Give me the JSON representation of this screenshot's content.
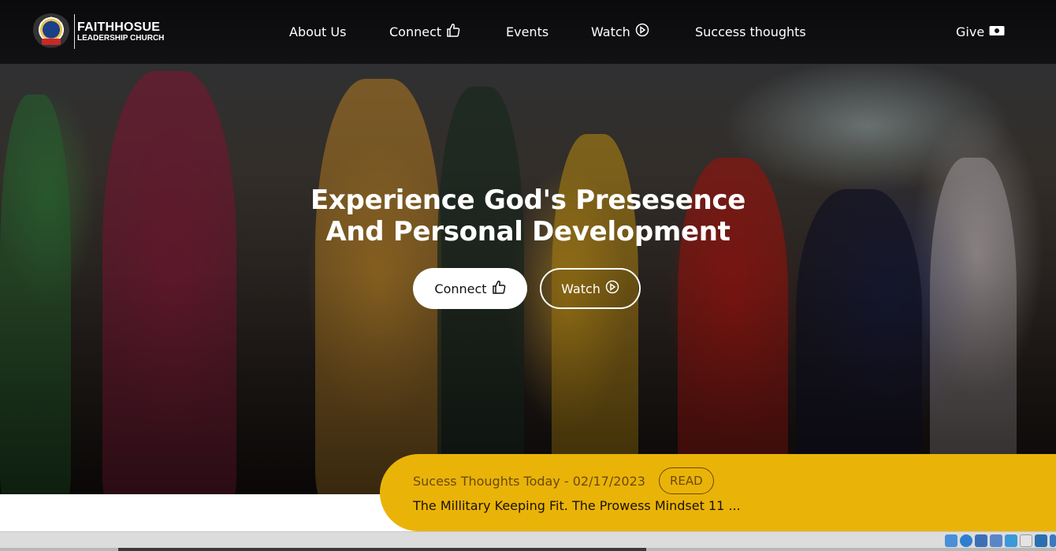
{
  "brand": {
    "name_line1": "FAITHHOSUE",
    "name_line2": "LEADERSHIP CHURCH",
    "logo_icon": "church-emblem-icon"
  },
  "nav": {
    "items": [
      {
        "label": "About Us",
        "icon": null
      },
      {
        "label": "Connect",
        "icon": "thumbs-up-icon"
      },
      {
        "label": "Events",
        "icon": null
      },
      {
        "label": "Watch",
        "icon": "play-circle-icon"
      },
      {
        "label": "Success thoughts",
        "icon": null
      },
      {
        "label": "Give",
        "icon": "money-icon"
      }
    ]
  },
  "hero": {
    "headline_line1": "Experience God's Presesence",
    "headline_line2": "And Personal Development",
    "primary_button": "Connect",
    "secondary_button": "Watch"
  },
  "banner": {
    "date_text": "Sucess Thoughts Today - 02/17/2023",
    "read_label": "READ",
    "title": "The Millitary Keeping Fit. The Prowess Mindset 11 ..."
  },
  "colors": {
    "accent": "#eab308",
    "nav_bg": "#0b0b0d",
    "text_light": "#ffffff"
  },
  "statusbar": {
    "tray_icons": [
      "network-icon",
      "disc-icon",
      "usb-icon",
      "display-icon",
      "pen-icon",
      "window-icon",
      "monitor-icon",
      "drive-icon"
    ]
  }
}
